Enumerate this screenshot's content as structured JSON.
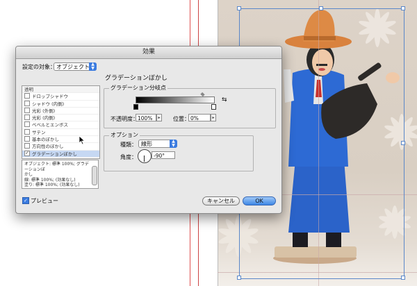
{
  "dialog": {
    "title": "効果",
    "target_label": "設定の対象：",
    "target_value": "オブジェクト",
    "effect_list": [
      {
        "label": "透明",
        "checkbox": false,
        "checked": false
      },
      {
        "label": "ドロップシャドウ",
        "checkbox": true,
        "checked": false
      },
      {
        "label": "シャドウ (内側)",
        "checkbox": true,
        "checked": false
      },
      {
        "label": "光彩 (外側)",
        "checkbox": true,
        "checked": false
      },
      {
        "label": "光彩 (内側)",
        "checkbox": true,
        "checked": false
      },
      {
        "label": "ベベルとエンボス",
        "checkbox": true,
        "checked": false
      },
      {
        "label": "サテン",
        "checkbox": true,
        "checked": false
      },
      {
        "label": "基本のぼかし",
        "checkbox": true,
        "checked": false
      },
      {
        "label": "方向性のぼかし",
        "checkbox": true,
        "checked": false
      },
      {
        "label": "グラデーションぼかし",
        "checkbox": true,
        "checked": true
      }
    ],
    "summary_lines": [
      "オブジェクト: 標準 100%; グラデーションぼ",
      "かし",
      "線: 標準 100%; (効果なし)",
      "塗り: 標準 100%; (効果なし)"
    ],
    "section_title": "グラデーションぼかし",
    "gradient_stops_group": "グラデーション分岐点",
    "opacity_label": "不透明度：",
    "opacity_value": "100%",
    "position_label": "位置：",
    "position_value": "0%",
    "options_group": "オプション",
    "type_label": "種類：",
    "type_value": "線形",
    "angle_label": "角度：",
    "angle_value": "-90°",
    "preview_label": "プレビュー",
    "preview_checked": true,
    "cancel_label": "キャンセル",
    "ok_label": "OK"
  },
  "colors": {
    "accent": "#3a7be0",
    "guide": "#e05050",
    "selection": "#5a87c9"
  }
}
